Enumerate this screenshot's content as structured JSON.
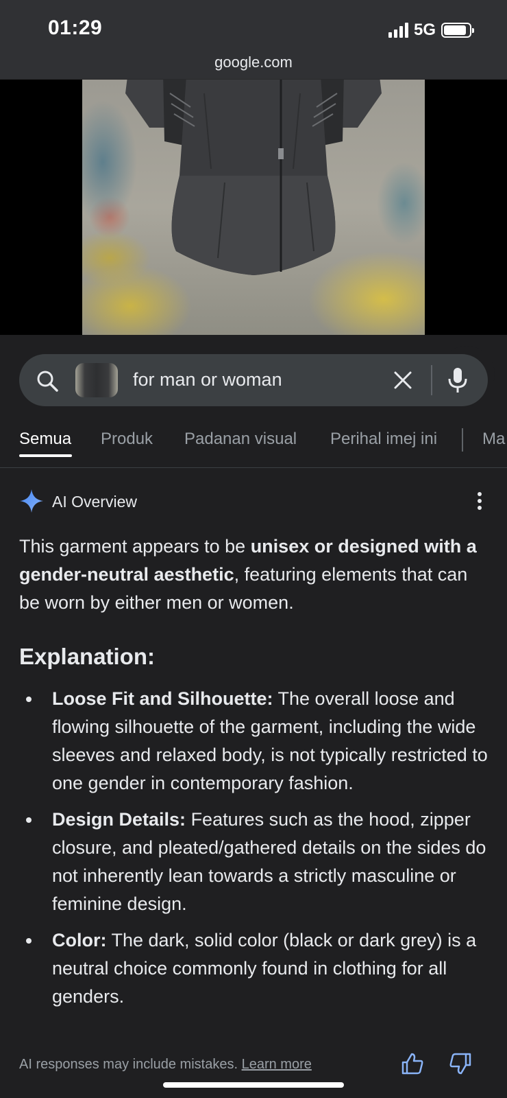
{
  "status_bar": {
    "time": "01:29",
    "network": "5G",
    "battery_level": 0.9
  },
  "browser": {
    "url": "google.com"
  },
  "hero": {
    "icons": [
      "translate-icon"
    ]
  },
  "search": {
    "query": "for man or woman",
    "icons": [
      "search-icon",
      "clear-icon",
      "mic-icon"
    ]
  },
  "tabs": [
    {
      "label": "Semua",
      "active": true
    },
    {
      "label": "Produk",
      "active": false
    },
    {
      "label": "Padanan visual",
      "active": false
    },
    {
      "label": "Perihal imej ini",
      "active": false
    },
    {
      "label": "Ma",
      "active": false
    }
  ],
  "ai_overview": {
    "title": "AI Overview",
    "summary_intro": "This garment appears to be ",
    "summary_bold": "unisex or designed with a gender-neutral aesthetic",
    "summary_rest": ", featuring elements that can be worn by either men or women.",
    "section_title": "Explanation:",
    "bullets": [
      {
        "title": "Loose Fit and Silhouette:",
        "text": " The overall loose and flowing silhouette of the garment, including the wide sleeves and relaxed body, is not typically restricted to one gender in contemporary fashion."
      },
      {
        "title": "Design Details:",
        "text": " Features such as the hood, zipper closure, and pleated/gathered details on the sides do not inherently lean towards a strictly masculine or feminine design."
      },
      {
        "title": "Color:",
        "text": " The dark, solid color (black or dark grey) is a neutral choice commonly found in clothing for all genders."
      }
    ]
  },
  "footer": {
    "note": "AI responses may include mistakes.",
    "learn_more": "Learn more"
  },
  "colors": {
    "background": "#1f1f21",
    "surface": "#303134",
    "search_bg": "#3c4043",
    "text": "#e8eaed",
    "muted": "#9aa0a6",
    "accent_blue": "#8ab4f8"
  }
}
